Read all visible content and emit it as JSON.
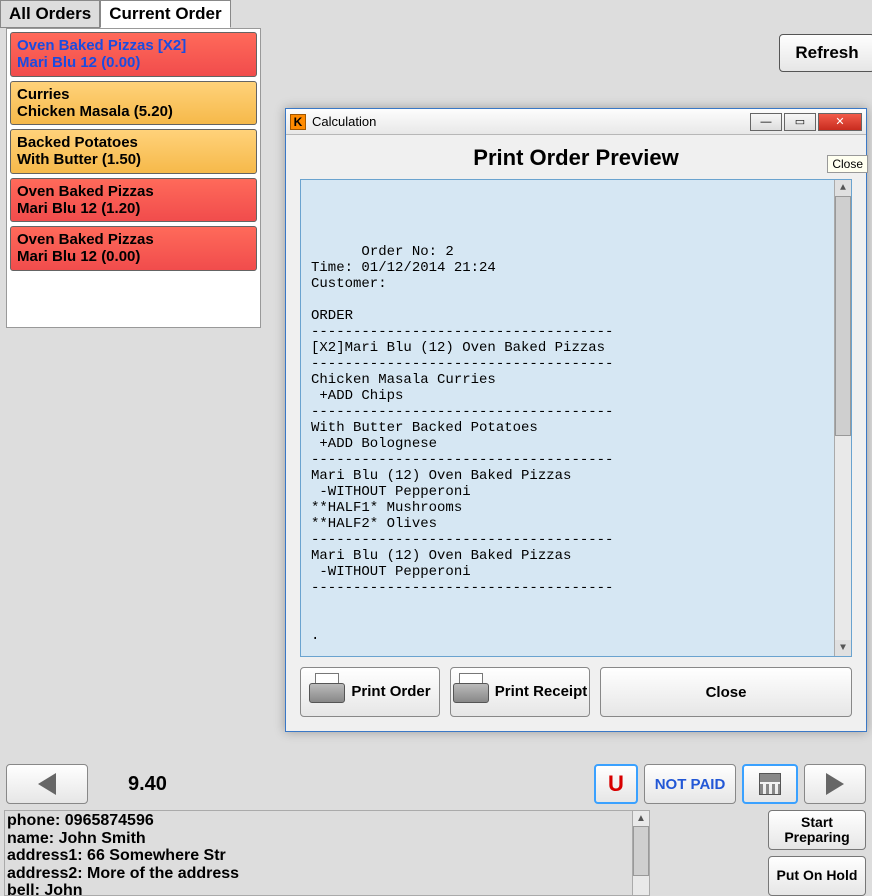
{
  "tabs": {
    "all": "All Orders",
    "current": "Current Order"
  },
  "order_items": [
    {
      "line1": "Oven Baked Pizzas [X2]",
      "line2": "Mari Blu 12 (0.00)",
      "color": "red",
      "selected": true
    },
    {
      "line1": "Curries",
      "line2": "Chicken Masala  (5.20)",
      "color": "orange",
      "selected": false
    },
    {
      "line1": "Backed Potatoes",
      "line2": "With Butter  (1.50)",
      "color": "orange",
      "selected": false
    },
    {
      "line1": "Oven Baked Pizzas",
      "line2": "Mari Blu 12 (1.20)",
      "color": "red",
      "selected": false
    },
    {
      "line1": "Oven Baked Pizzas",
      "line2": "Mari Blu 12 (0.00)",
      "color": "red",
      "selected": false
    }
  ],
  "refresh": "Refresh",
  "total": "9.40",
  "bottom": {
    "u": "U",
    "notpaid": "NOT PAID"
  },
  "customer": {
    "phone": "phone: 0965874596",
    "name": "name: John Smith",
    "addr1": "address1: 66 Somewhere Str",
    "addr2": "address2: More of the address",
    "bell": "bell: John"
  },
  "actions": {
    "start": "Start Preparing",
    "hold": "Put On Hold"
  },
  "dialog": {
    "title": "Calculation",
    "close_tip": "Close",
    "heading": "Print Order Preview",
    "receipt": "Order No: 2\nTime: 01/12/2014 21:24\nCustomer:\n\nORDER\n------------------------------------\n[X2]Mari Blu (12) Oven Baked Pizzas\n------------------------------------\nChicken Masala Curries\n +ADD Chips\n------------------------------------\nWith Butter Backed Potatoes\n +ADD Bolognese\n------------------------------------\nMari Blu (12) Oven Baked Pizzas\n -WITHOUT Pepperoni\n**HALF1* Mushrooms\n**HALF2* Olives\n------------------------------------\nMari Blu (12) Oven Baked Pizzas\n -WITHOUT Pepperoni\n------------------------------------\n\n\n.",
    "print_order": "Print\nOrder",
    "print_receipt": "Print\nReceipt",
    "close": "Close"
  }
}
